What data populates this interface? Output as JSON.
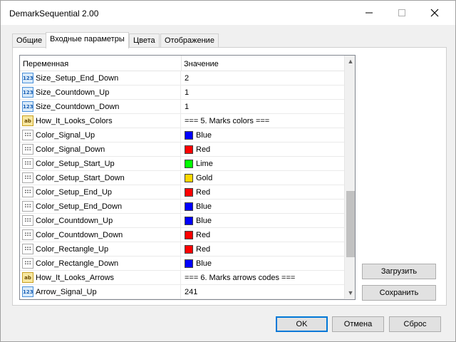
{
  "window": {
    "title": "DemarkSequential 2.00"
  },
  "tabs": [
    {
      "label": "Общие",
      "active": false
    },
    {
      "label": "Входные параметры",
      "active": true
    },
    {
      "label": "Цвета",
      "active": false
    },
    {
      "label": "Отображение",
      "active": false
    }
  ],
  "grid": {
    "headers": {
      "name": "Переменная",
      "value": "Значение"
    },
    "rows": [
      {
        "type": "num",
        "name": "Size_Setup_End_Down",
        "value": "2"
      },
      {
        "type": "num",
        "name": "Size_Countdown_Up",
        "value": "1"
      },
      {
        "type": "num",
        "name": "Size_Countdown_Down",
        "value": "1"
      },
      {
        "type": "str",
        "name": "How_It_Looks_Colors",
        "value": "=== 5. Marks colors ==="
      },
      {
        "type": "clr",
        "name": "Color_Signal_Up",
        "value": "Blue",
        "color": "#0000ff"
      },
      {
        "type": "clr",
        "name": "Color_Signal_Down",
        "value": "Red",
        "color": "#ff0000"
      },
      {
        "type": "clr",
        "name": "Color_Setup_Start_Up",
        "value": "Lime",
        "color": "#00ff00"
      },
      {
        "type": "clr",
        "name": "Color_Setup_Start_Down",
        "value": "Gold",
        "color": "#ffd700"
      },
      {
        "type": "clr",
        "name": "Color_Setup_End_Up",
        "value": "Red",
        "color": "#ff0000"
      },
      {
        "type": "clr",
        "name": "Color_Setup_End_Down",
        "value": "Blue",
        "color": "#0000ff"
      },
      {
        "type": "clr",
        "name": "Color_Countdown_Up",
        "value": "Blue",
        "color": "#0000ff"
      },
      {
        "type": "clr",
        "name": "Color_Countdown_Down",
        "value": "Red",
        "color": "#ff0000"
      },
      {
        "type": "clr",
        "name": "Color_Rectangle_Up",
        "value": "Red",
        "color": "#ff0000"
      },
      {
        "type": "clr",
        "name": "Color_Rectangle_Down",
        "value": "Blue",
        "color": "#0000ff"
      },
      {
        "type": "str",
        "name": "How_It_Looks_Arrows",
        "value": "=== 6. Marks arrows codes ==="
      },
      {
        "type": "num",
        "name": "Arrow_Signal_Up",
        "value": "241"
      }
    ]
  },
  "icons": {
    "num": "123",
    "str": "ab",
    "clr": ":::"
  },
  "side_buttons": {
    "load": "Загрузить",
    "save": "Сохранить"
  },
  "footer_buttons": {
    "ok": "OK",
    "cancel": "Отмена",
    "reset": "Сброс"
  }
}
